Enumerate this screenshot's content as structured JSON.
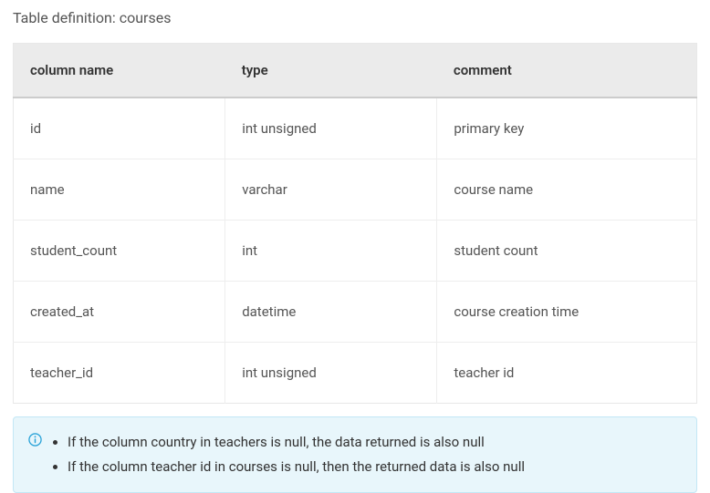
{
  "title": "Table definition: courses",
  "headers": {
    "col1": "column name",
    "col2": "type",
    "col3": "comment"
  },
  "rows": [
    {
      "name": "id",
      "type": "int unsigned",
      "comment": "primary key"
    },
    {
      "name": "name",
      "type": "varchar",
      "comment": "course name"
    },
    {
      "name": "student_count",
      "type": "int",
      "comment": "student count"
    },
    {
      "name": "created_at",
      "type": "datetime",
      "comment": "course creation time"
    },
    {
      "name": "teacher_id",
      "type": "int unsigned",
      "comment": "teacher id"
    }
  ],
  "notes": [
    "If the column country in teachers is null, the data returned is also null",
    "If the column teacher id in courses is null, then the returned data is also null"
  ]
}
